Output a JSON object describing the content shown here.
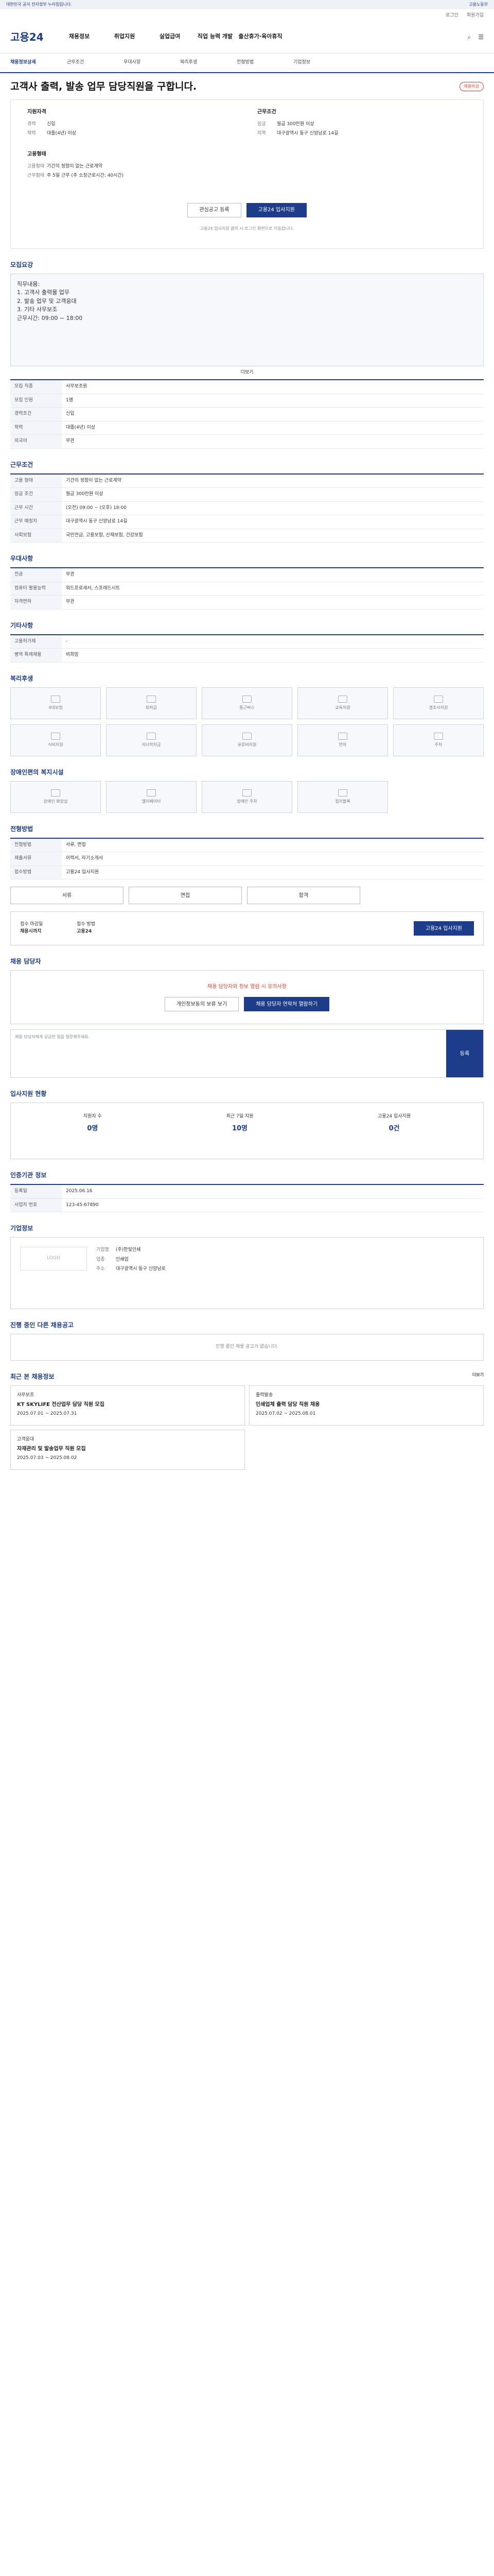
{
  "topbar": {
    "left": "대한민국 공식 전자정부 누리집입니다.",
    "right": "고용노동부"
  },
  "util": [
    "로그인",
    "회원가입"
  ],
  "header": {
    "logo": "고용24",
    "gnb": [
      "채용정보",
      "취업지원",
      "실업급여",
      "직업 능력 개발",
      "출산휴가·육아휴직"
    ],
    "right": [
      "검색",
      "메뉴"
    ]
  },
  "subnav": [
    "채용정보상세",
    "근무조건",
    "우대사항",
    "복리후생",
    "전형방법",
    "기업정보"
  ],
  "title": "고객사 출력, 발송 업무 담당직원을 구합니다.",
  "badge": "채용마감",
  "summary": {
    "left_title": "지원자격",
    "left": [
      [
        "경력",
        "신입"
      ],
      [
        "학력",
        "대졸(4년) 이상"
      ]
    ],
    "right_title": "근무조건",
    "right": [
      [
        "임금",
        "월급 300만원 이상"
      ],
      [
        "지역",
        "대구광역시 동구 신암남로 14길"
      ]
    ],
    "left2_title": "고용형태",
    "left2": [
      [
        "고용형태",
        "기간의 정함이 없는 근로계약"
      ],
      [
        "근무형태",
        "주 5일 근무 (주 소정근로시간: 40시간)"
      ]
    ],
    "btn_scrap": "관심공고 등록",
    "btn_apply": "고용24 입사지원",
    "notice": "고용24 입사지원 클릭 시 로그인 화면으로 이동합니다."
  },
  "sections": {
    "job": "모집요강",
    "job_desc": [
      "직무내용:",
      "1. 고객사 출력물 업무",
      "2. 발송 업무 및 고객응대",
      "3. 기타 사무보조",
      "근무시간: 09:00 ~ 18:00"
    ],
    "job_more": "더보기",
    "job_table": [
      [
        "모집 직종",
        "사무보조원"
      ],
      [
        "모집 인원",
        "1명"
      ],
      [
        "경력조건",
        "신입"
      ],
      [
        "학력",
        "대졸(4년) 이상"
      ],
      [
        "외국어",
        "무관"
      ]
    ],
    "cond": "근무조건",
    "cond_table": [
      [
        "고용 형태",
        "기간의 정함이 없는 근로계약"
      ],
      [
        "임금 조건",
        "월급 300만원 이상"
      ],
      [
        "근무 시간",
        "(오전) 09:00 ~ (오후) 18:00"
      ],
      [
        "근무 예정지",
        "대구광역시 동구 신암남로 14길"
      ],
      [
        "사회보험",
        "국민연금, 고용보험, 산재보험, 건강보험"
      ]
    ],
    "pref": "우대사항",
    "pref_table": [
      [
        "전공",
        "무관"
      ],
      [
        "컴퓨터 활용능력",
        "워드프로세서, 스프레드시트"
      ],
      [
        "자격면허",
        "무관"
      ]
    ],
    "etc": "기타사항",
    "etc_table": [
      [
        "고용허가제",
        "-"
      ],
      [
        "병역 특례채용",
        "비희망"
      ]
    ],
    "benefit": "복리후생",
    "benefit_tiles": [
      "4대보험",
      "퇴직금",
      "통근버스",
      "교육지원",
      "경조사지원",
      "식비지원",
      "자녀학자금",
      "유류비지원",
      "연차",
      "주차"
    ],
    "disab": "장애인편의 복지시설",
    "disab_tiles": [
      "장애인 화장실",
      "엘리베이터",
      "장애인 주차",
      "점자블록"
    ],
    "select": "전형방법",
    "select_table": [
      [
        "전형방법",
        "서류, 면접"
      ],
      [
        "제출서류",
        "이력서, 자기소개서"
      ],
      [
        "접수방법",
        "고용24 입사지원"
      ]
    ],
    "proc_btns": [
      "서류",
      "면접",
      "합격"
    ],
    "apply_info": [
      [
        "접수 마감일",
        "채용시까지"
      ],
      [
        "접수 방법",
        "고용24"
      ]
    ],
    "apply_btn": "고용24 입사지원",
    "manager": "채용 담당자",
    "manager_notice": "채용 담당자와 정보 열람 시 유의사항",
    "manager_btns": [
      "개인정보동의 보류 보기",
      "채용 담당자 연락처 열람하기"
    ],
    "qna_placeholder": "채용 담당자에게 궁금한 점을 질문해주세요.",
    "qna_send": "등록",
    "stat_title": "입사지원 현황",
    "stats": [
      [
        "지원자 수",
        "0명"
      ],
      [
        "최근 7일 지원",
        "10명"
      ],
      [
        "고용24 입사지원",
        "0건"
      ]
    ],
    "reg": "인증기관 정보",
    "reg_table": [
      [
        "등록일",
        "2025.06.16"
      ],
      [
        "사업자 번호",
        "123-45-67890"
      ]
    ],
    "company": "기업정보",
    "company_logo": "LOGO",
    "company_kv": [
      [
        "기업명",
        "(주)한빛인쇄"
      ],
      [
        "업종",
        "인쇄업"
      ],
      [
        "주소",
        "대구광역시 동구 신암남로"
      ]
    ],
    "related": "진행 중인 다른 채용공고",
    "related_empty": "진행 중인 채용 공고가 없습니다.",
    "recent": "최근 본 채용정보",
    "recent_more": "더보기",
    "recent_cards": [
      {
        "tag": "사무보조",
        "title": "KT SKYLIFE 전산업무 담당 직원 모집",
        "date": "2025.07.01 ~ 2025.07.31"
      },
      {
        "tag": "출력발송",
        "title": "인쇄업체 출력 담당 직원 채용",
        "date": "2025.07.02 ~ 2025.08.01"
      },
      {
        "tag": "고객응대",
        "title": "자재관리 및 발송업무 직원 모집",
        "date": "2025.07.03 ~ 2025.08.02"
      }
    ]
  }
}
